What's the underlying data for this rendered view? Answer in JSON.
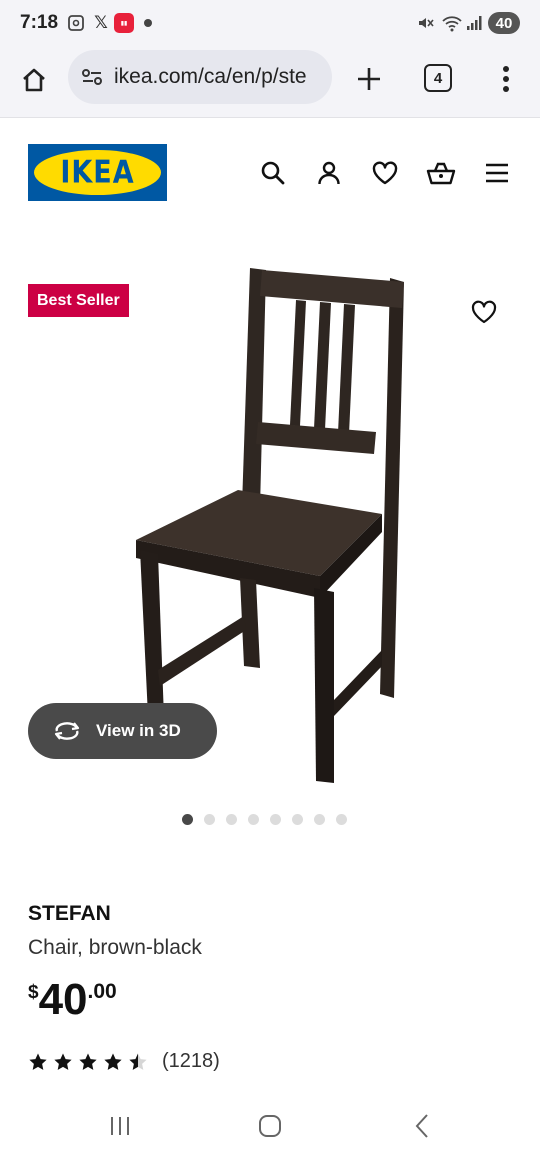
{
  "status_bar": {
    "time": "7:18",
    "x_label": "𝕏",
    "battery": "40"
  },
  "browser": {
    "url": "ikea.com/ca/en/p/ste",
    "tab_count": "4"
  },
  "header": {
    "logo_text": "IKEA",
    "brand_colors": {
      "blue": "#0058a3",
      "yellow": "#ffdb00"
    }
  },
  "product_media": {
    "badge": "Best Seller",
    "badge_color": "#cc0044",
    "view_3d_label": "View in 3D",
    "carousel_dots": 8,
    "active_dot": 0
  },
  "product": {
    "name": "STEFAN",
    "description": "Chair, brown-black",
    "price_currency": "$",
    "price_integer": "40",
    "price_decimal": ".00",
    "rating_value": 4.5,
    "rating_max": 5,
    "review_count": "(1218)"
  },
  "icons": [
    "home-icon",
    "site-settings-icon",
    "plus-icon",
    "tabs-icon",
    "more-icon",
    "search-icon",
    "profile-icon",
    "heart-icon",
    "basket-icon",
    "hamburger-icon",
    "rotate-3d-icon",
    "star-icon",
    "recents-icon",
    "home-nav-icon",
    "back-icon"
  ]
}
